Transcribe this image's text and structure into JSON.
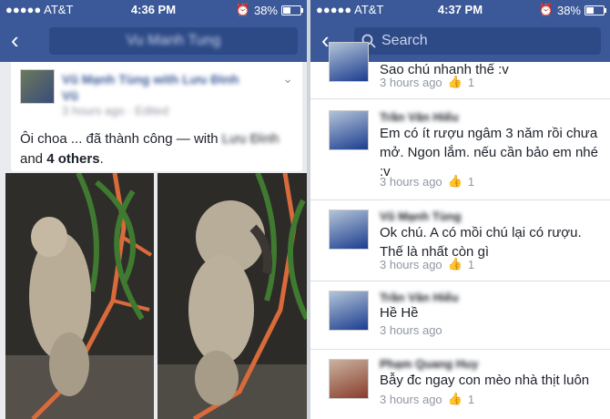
{
  "left": {
    "status": {
      "carrier": "●●●●● AT&T",
      "time": "4:36 PM",
      "battery": "38%"
    },
    "nav": {
      "title": "Vu Manh Tung"
    },
    "post": {
      "author": "Vũ Mạnh Tùng with Lưu Đình Vũ",
      "meta": "3 hours ago · Edited",
      "text_prefix": "Ôi choa ... đã thành công — with",
      "tagged": "Lưu Đình",
      "text_and": "and",
      "others": "4 others",
      "text_end": "."
    }
  },
  "right": {
    "status": {
      "carrier": "●●●●● AT&T",
      "time": "4:37 PM",
      "battery": "38%"
    },
    "search": {
      "placeholder": "Search"
    },
    "comments": [
      {
        "name": "",
        "text": "Sao chú nhanh thế :v",
        "time": "3 hours ago",
        "likes": "1"
      },
      {
        "name": "Trần Văn Hiếu",
        "text": "Em có ít rượu ngâm 3 năm rồi chưa mở. Ngon lắm. nếu cần bảo em nhé :v",
        "time": "3 hours ago",
        "likes": "1"
      },
      {
        "name": "Vũ Mạnh Tùng",
        "text": "Ok chú. A có mồi chú lại có rượu. Thế là nhất còn gì",
        "time": "3 hours ago",
        "likes": "1"
      },
      {
        "name": "Trần Văn Hiếu",
        "text": "Hề Hề",
        "time": "3 hours ago",
        "likes": ""
      },
      {
        "name": "Phạm Quang Huy",
        "text": "Bẫy đc ngay con mèo nhà thịt luôn",
        "time": "3 hours ago",
        "likes": "1"
      }
    ]
  },
  "icons": [
    "back-chevron-icon",
    "search-icon",
    "like-thumb-icon",
    "wifi-icon",
    "alarm-icon",
    "battery-icon",
    "more-chevron-icon"
  ]
}
